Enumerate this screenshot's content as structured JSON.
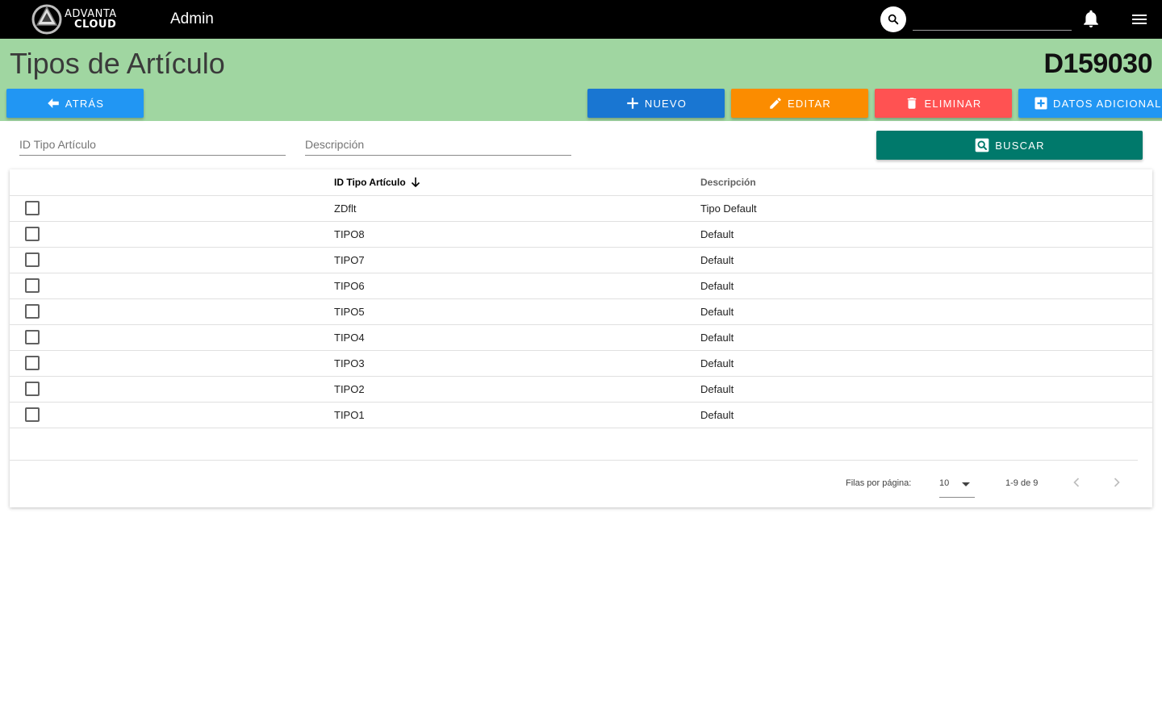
{
  "appbar": {
    "logo_line1": "ADVANTA",
    "logo_line2": "CLOUD",
    "title": "Admin",
    "search_placeholder": "",
    "icons": [
      "search-icon",
      "bell-icon",
      "menu-icon"
    ]
  },
  "header": {
    "title": "Tipos de Artículo",
    "company_code": "D159030",
    "background": "#a0d6a1"
  },
  "toolbar": {
    "back_label": "ATRÁS",
    "new_label": "NUEVO",
    "edit_label": "EDITAR",
    "delete_label": "ELIMINAR",
    "extra_label": "DATOS ADICIONALES",
    "colors": {
      "back": "#2196f3",
      "new": "#1976d2",
      "edit": "#fb8c00",
      "delete": "#ff5252",
      "extra": "#2196f3"
    }
  },
  "filters": {
    "id_placeholder": "ID Tipo Artículo",
    "desc_placeholder": "Descripción",
    "search_label": "BUSCAR",
    "search_color": "#00796b"
  },
  "table": {
    "columns": [
      "",
      "ID Tipo Artículo",
      "Descripción"
    ],
    "sorted_column": "ID Tipo Artículo",
    "sort_direction": "descending",
    "rows": [
      {
        "id": "ZDflt",
        "desc": "Tipo Default"
      },
      {
        "id": "TIPO8",
        "desc": "Default"
      },
      {
        "id": "TIPO7",
        "desc": "Default"
      },
      {
        "id": "TIPO6",
        "desc": "Default"
      },
      {
        "id": "TIPO5",
        "desc": "Default"
      },
      {
        "id": "TIPO4",
        "desc": "Default"
      },
      {
        "id": "TIPO3",
        "desc": "Default"
      },
      {
        "id": "TIPO2",
        "desc": "Default"
      },
      {
        "id": "TIPO1",
        "desc": "Default"
      }
    ]
  },
  "pagination": {
    "rows_per_page_label": "Filas por página:",
    "rows_per_page": "10",
    "range": "1-9 de 9"
  }
}
